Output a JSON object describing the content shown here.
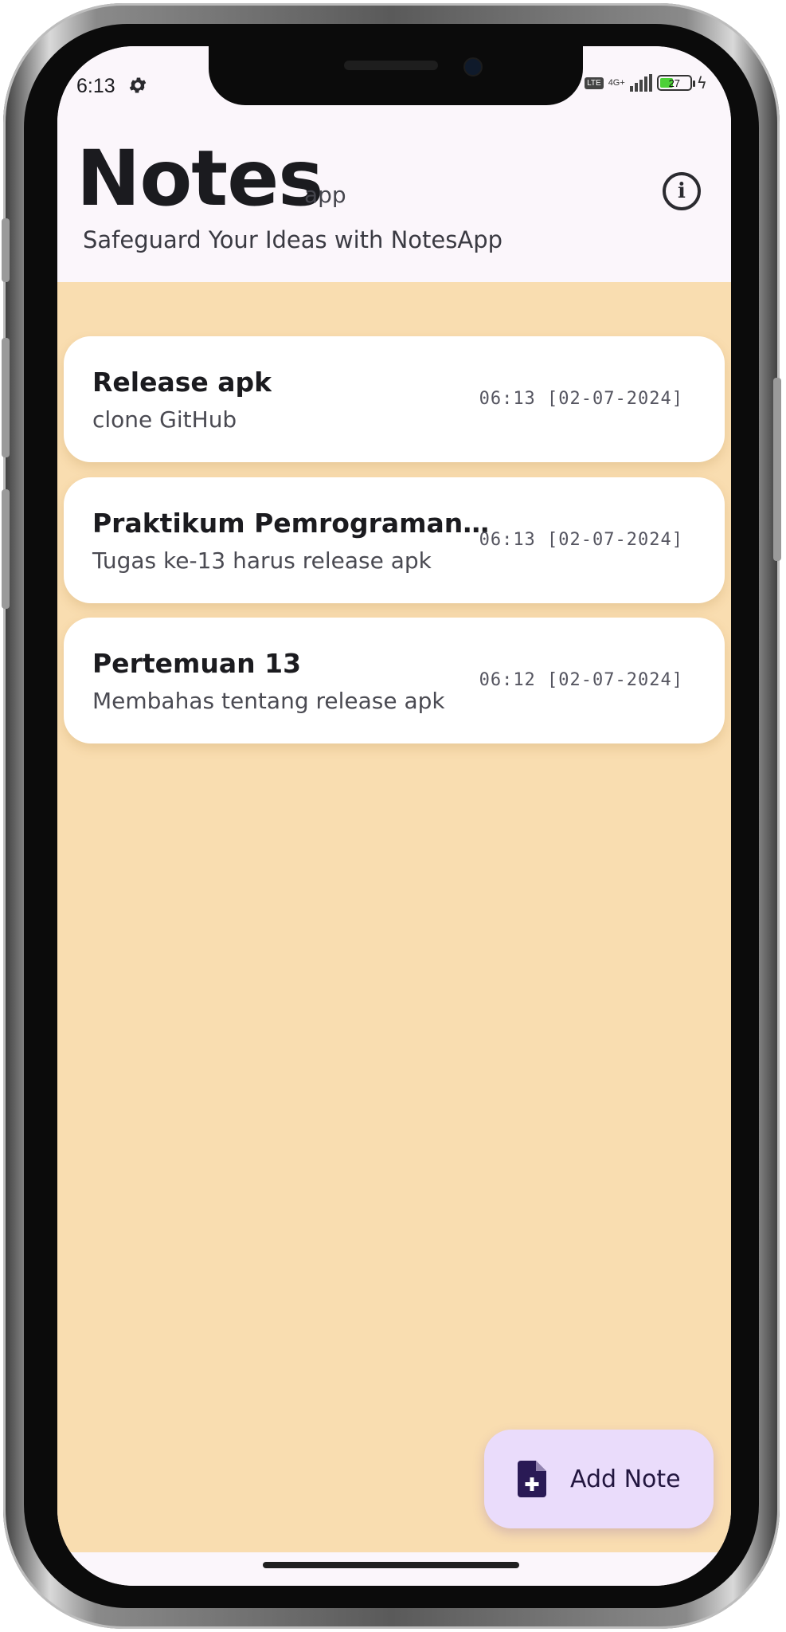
{
  "status_bar": {
    "time": "6:13",
    "network_type": "4G+",
    "lte_label": "LTE",
    "battery_level": "27"
  },
  "header": {
    "title": "Notes",
    "title_suffix": "app",
    "tagline": "Safeguard Your Ideas with NotesApp",
    "info_label": "i"
  },
  "notes": [
    {
      "title": "Release apk",
      "description": "clone GitHub",
      "timestamp": "06:13 [02-07-2024]"
    },
    {
      "title": "Praktikum Pemrograman Mobile",
      "description": "Tugas ke-13 harus release apk",
      "timestamp": "06:13 [02-07-2024]"
    },
    {
      "title": "Pertemuan 13",
      "description": "Membahas tentang release apk",
      "timestamp": "06:12 [02-07-2024]"
    }
  ],
  "fab": {
    "label": "Add Note",
    "icon": "note-add-icon"
  },
  "colors": {
    "background": "#f9ddb0",
    "header": "#fbf6fb",
    "card": "#ffffff",
    "fab": "#eadcfb",
    "fab_icon": "#2a1a55"
  }
}
